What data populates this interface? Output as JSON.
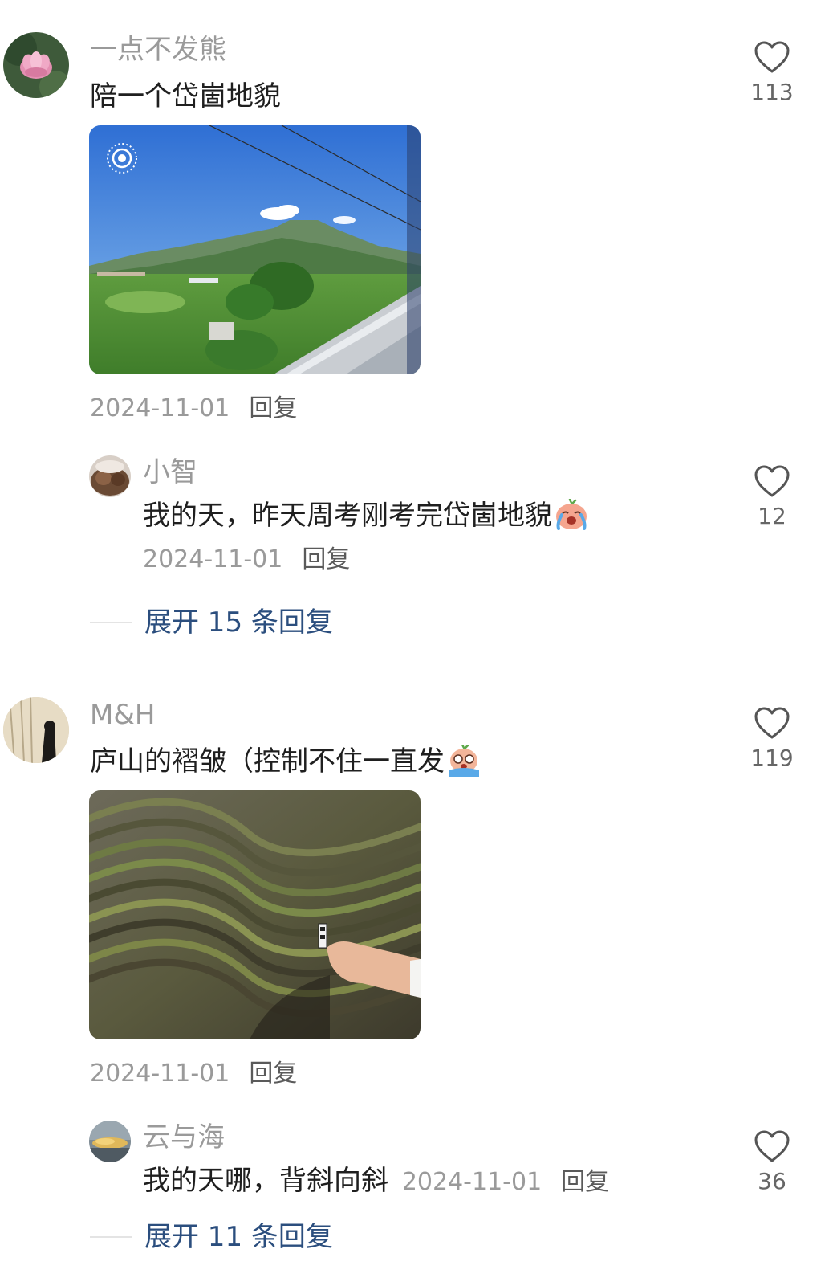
{
  "comments": [
    {
      "username": "一点不发熊",
      "text": "陪一个岱崮地貌",
      "date": "2024-11-01",
      "reply_label": "回复",
      "likes": "113",
      "replies": [
        {
          "username": "小智",
          "text": "我的天，昨天周考刚考完岱崮地貌",
          "date": "2024-11-01",
          "reply_label": "回复",
          "likes": "12"
        }
      ],
      "expand_label": "展开 15 条回复"
    },
    {
      "username": "M&H",
      "text": "庐山的褶皱（控制不住一直发",
      "date": "2024-11-01",
      "reply_label": "回复",
      "likes": "119",
      "replies": [
        {
          "username": "云与海",
          "text": "我的天哪，背斜向斜",
          "date": "2024-11-01",
          "reply_label": "回复",
          "likes": "36"
        }
      ],
      "expand_label": "展开 11 条回复"
    }
  ],
  "colors": {
    "link_blue": "#2b4e7e",
    "meta_gray": "#9a9a9a",
    "text_dark": "#1f1f1f"
  },
  "icons": [
    "heart-outline-icon",
    "crying-emoji-icon",
    "live-photo-icon"
  ]
}
